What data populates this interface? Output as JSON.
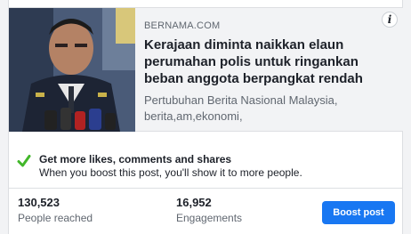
{
  "link_preview": {
    "domain": "BERNAMA.COM",
    "headline": "Kerajaan diminta naikkan elaun perumahan polis untuk ringankan beban anggota berpangkat rendah",
    "description": "Pertubuhan Berita Nasional Malaysia, berita,am,ekonomi,",
    "info_icon": "i"
  },
  "boost_tip": {
    "title": "Get more likes, comments and shares",
    "subtitle": "When you boost this post, you'll show it to more people."
  },
  "stats": {
    "people_reached_value": "130,523",
    "people_reached_label": "People reached",
    "engagements_value": "16,952",
    "engagements_label": "Engagements"
  },
  "actions": {
    "boost_label": "Boost post"
  },
  "colors": {
    "brand_blue": "#1877f2",
    "check_green": "#42b72a"
  }
}
